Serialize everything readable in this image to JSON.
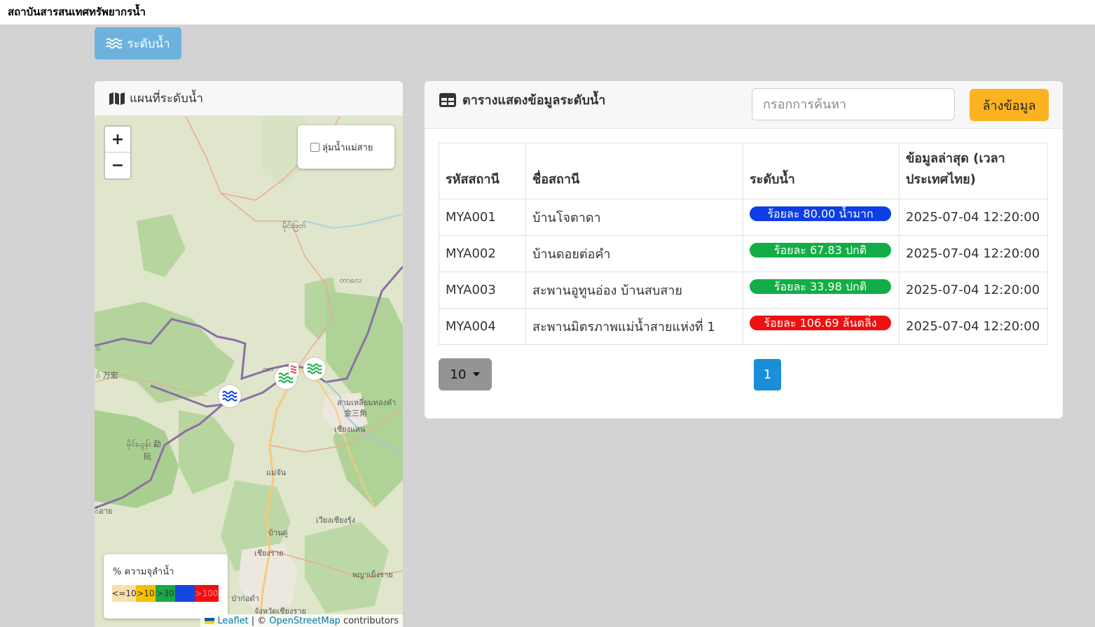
{
  "app": {
    "title": "สถาบันสารสนเทศทรัพยากรน้ำ"
  },
  "nav": {
    "water_level_tab": "ระดับน้ำ",
    "tab_icon": "water-waves-icon"
  },
  "map_card": {
    "title": "แผนที่ระดับน้ำ",
    "title_icon": "map-icon",
    "zoom_in": "+",
    "zoom_out": "−",
    "layer_toggle_label": "ลุ่มน้ำแม่สาย",
    "places": [
      "မိုင်းဖြတ်",
      "တာလေ",
      "တာ",
      "สามเหลี่ยมทองคำ",
      "金三角",
      "เชียงแสน",
      "မိုင်းယွန်း 勐",
      "阮",
      "แม่จัน",
      "เวียงเชียงรุ้ง",
      "บ้านดู่",
      "เชียงราย",
      "พญาเม็งราย",
      "ป่าก่อดำ",
      "จังหวัดเชียงราย",
      "ဝ",
      "ဝ် 万宏",
      "ဝ်อาย"
    ],
    "legend": {
      "title": "% ความจุลำน้ำ",
      "items": [
        {
          "label": "<=10",
          "color": "#f7dfb0"
        },
        {
          "label": ">10",
          "color": "#f5c000"
        },
        {
          "label": ">30",
          "color": "#1ca84a"
        },
        {
          "label": ">70",
          "color": "#1546e0"
        },
        {
          "label": ">100",
          "color": "#ee1111"
        }
      ]
    },
    "attribution": {
      "leaflet": "Leaflet",
      "sep": "| ©",
      "osm": "OpenStreetMap",
      "contrib": "contributors"
    }
  },
  "table_card": {
    "title": "ตารางแสดงข้อมูลระดับน้ำ",
    "title_icon": "table-icon",
    "search_placeholder": "กรอกการค้นหา",
    "clear_label": "ล้างข้อมูล",
    "columns": [
      "รหัสสถานี",
      "ชื่อสถานี",
      "ระดับน้ำ",
      "ข้อมูลล่าสุด (เวลา",
      "ประเทศไทย)"
    ],
    "rows": [
      {
        "code": "MYA001",
        "name": "บ้านโจตาดา",
        "level": "ร้อยละ 80.00 น้ำมาก",
        "color": "#0d3ee8",
        "updated": "2025-07-04 12:20:00"
      },
      {
        "code": "MYA002",
        "name": "บ้านดอยต่อคำ",
        "level": "ร้อยละ 67.83 ปกติ",
        "color": "#12ad46",
        "updated": "2025-07-04 12:20:00"
      },
      {
        "code": "MYA003",
        "name": "สะพานอูทูนอ่อง บ้านสบสาย",
        "level": "ร้อยละ 33.98 ปกติ",
        "color": "#12ad46",
        "updated": "2025-07-04 12:20:00"
      },
      {
        "code": "MYA004",
        "name": "สะพานมิตรภาพแม่น้ำสายแห่งที่ 1",
        "level": "ร้อยละ 106.69 ล้นตลิ่ง",
        "color": "#ee1111",
        "updated": "2025-07-04 12:20:00"
      }
    ],
    "page_size": "10",
    "current_page": "1"
  }
}
